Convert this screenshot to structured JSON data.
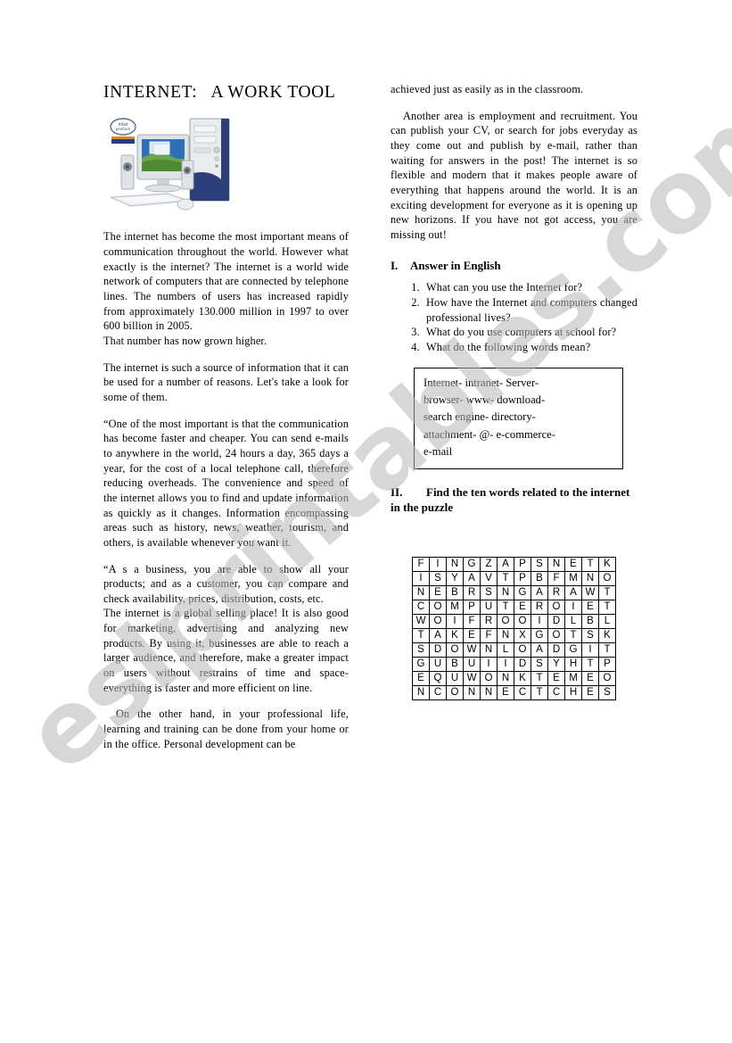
{
  "document": {
    "title": "INTERNET:   A WORK TOOL",
    "hero_image_name": "desktop-computer-photo",
    "watermark": "eslprintables.com"
  },
  "left_column": {
    "paragraphs": [
      "The internet has become the most important means of communication throughout the world. However what exactly is the internet? The internet is a world wide network of computers that are connected by telephone lines. The numbers of users has increased rapidly from approximately 130.000 million in 1997 to over 600 billion in 2005.",
      "That number has now grown higher.",
      "The internet is such a source of information that it can be used for a number of reasons. Let's take a look for some of them.",
      "“One of the most important is that the communication has become faster and cheaper. You can send e-mails to anywhere in the world, 24 hours a day, 365 days a year, for the cost of a local telephone call, therefore reducing overheads. The convenience and speed of the internet allows you to find and update information as quickly as it changes. Information encompassing areas such as history, news, weather, tourism, and others, is available whenever you want it.",
      "“A s a business, you are able to show all your products; and as a customer, you can compare and check availability, prices, distribution, costs, etc.",
      "The internet is a global selling place! It is also good for marketing, advertising and analyzing new products. By using it, businesses are able to reach a larger audience, and therefore, make a greater impact on users without restrains of time and space-everything is faster and more efficient on line.",
      "On the other hand, in your professional life, learning and training can be done from your home or in the office. Personal development can be"
    ]
  },
  "right_column": {
    "paragraphs": [
      "achieved just as easily as in the classroom.",
      "Another area is employment and recruitment. You can publish your CV, or search for jobs everyday as they come out and publish by e-mail, rather than waiting for answers in the post! The internet is so flexible and modern that it makes people aware of everything that happens around the world. It is an exciting development for everyone as it is opening up new horizons. If you have not got access, you are missing out!"
    ],
    "section_one": {
      "numeral": "I.",
      "heading": "Answer in English",
      "questions": [
        "What can you use the Internet for?",
        "How have the Internet and computers changed professional lives?",
        "What do you use computers at school for?",
        "What do the following words mean?"
      ]
    },
    "vocab_box": {
      "name": "vocabulary-box",
      "lines": [
        "Internet- intranet- Server-",
        "browser- www- download-",
        "search engine- directory-",
        "attachment- @- e-commerce-",
        "e-mail"
      ]
    },
    "section_two": {
      "numeral": "II.",
      "heading": "Find the ten words related to the internet in the puzzle"
    },
    "puzzle": {
      "name": "word-search-grid",
      "rows": 10,
      "cols": 12,
      "grid": [
        [
          "F",
          "I",
          "N",
          "G",
          "Z",
          "A",
          "P",
          "S",
          "N",
          "E",
          "T",
          "K"
        ],
        [
          "I",
          "S",
          "Y",
          "A",
          "V",
          "T",
          "P",
          "B",
          "F",
          "M",
          "N",
          "O"
        ],
        [
          "N",
          "E",
          "B",
          "R",
          "S",
          "N",
          "G",
          "A",
          "R",
          "A",
          "W",
          "T"
        ],
        [
          "C",
          "O",
          "M",
          "P",
          "U",
          "T",
          "E",
          "R",
          "O",
          "I",
          "E",
          "T"
        ],
        [
          "W",
          "O",
          "I",
          "F",
          "R",
          "O",
          "O",
          "I",
          "D",
          "L",
          "B",
          "L"
        ],
        [
          "T",
          "A",
          "K",
          "E",
          "F",
          "N",
          "X",
          "G",
          "O",
          "T",
          "S",
          "K"
        ],
        [
          "S",
          "D",
          "O",
          "W",
          "N",
          "L",
          "O",
          "A",
          "D",
          "G",
          "I",
          "T"
        ],
        [
          "G",
          "U",
          "B",
          "U",
          "I",
          "I",
          "D",
          "S",
          "Y",
          "H",
          "T",
          "P"
        ],
        [
          "E",
          "Q",
          "U",
          "W",
          "O",
          "N",
          "K",
          "T",
          "E",
          "M",
          "E",
          "O"
        ],
        [
          "N",
          "C",
          "O",
          "N",
          "N",
          "E",
          "C",
          "T",
          "C",
          "H",
          "E",
          "S"
        ]
      ]
    }
  },
  "colors": {
    "text": "#000000",
    "watermark": "#b8b8b8",
    "page_background": "#ffffff"
  }
}
